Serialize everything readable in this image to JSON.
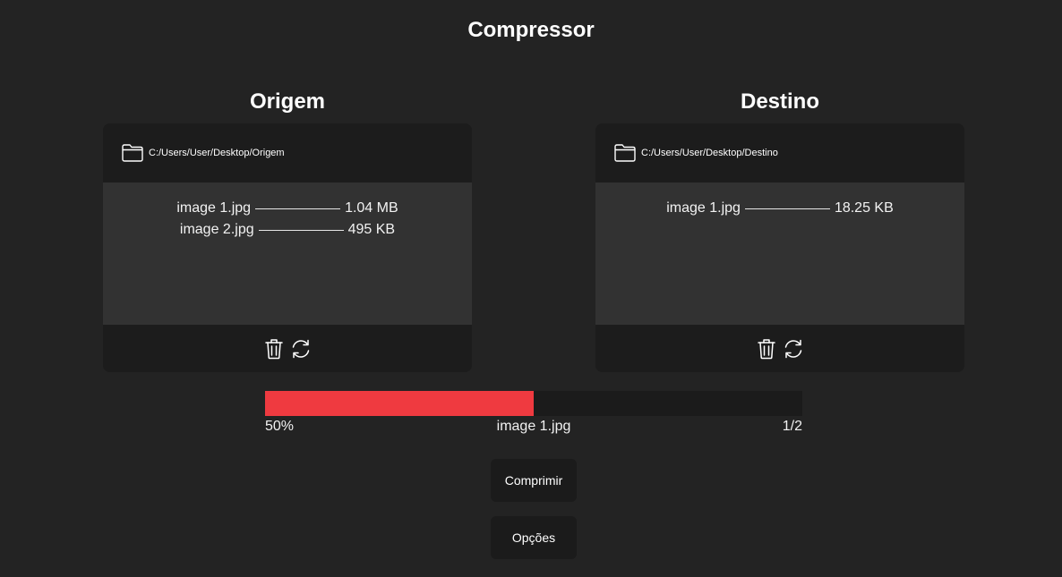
{
  "app": {
    "title": "Compressor"
  },
  "source": {
    "heading": "Origem",
    "path": "C:/Users/User/Desktop/Origem",
    "files": [
      {
        "name": "image 1.jpg",
        "size": "1.04 MB"
      },
      {
        "name": "image 2.jpg",
        "size": "495 KB"
      }
    ]
  },
  "destination": {
    "heading": "Destino",
    "path": "C:/Users/User/Desktop/Destino",
    "files": [
      {
        "name": "image 1.jpg",
        "size": "18.25 KB"
      }
    ]
  },
  "icons": {
    "folder": "folder-icon",
    "delete": "trash-icon",
    "refresh": "refresh-icon"
  },
  "progress": {
    "fraction": 0.5,
    "percent_label": "50%",
    "current_file": "image 1.jpg",
    "count_label": "1/2"
  },
  "buttons": {
    "compress_label": "Comprimir",
    "options_label": "Opções"
  },
  "colors": {
    "background": "#232323",
    "panel": "#1c1c1c",
    "list_background": "#323232",
    "progress_fill": "#ef3a40",
    "progress_track": "#1b1b1b"
  }
}
